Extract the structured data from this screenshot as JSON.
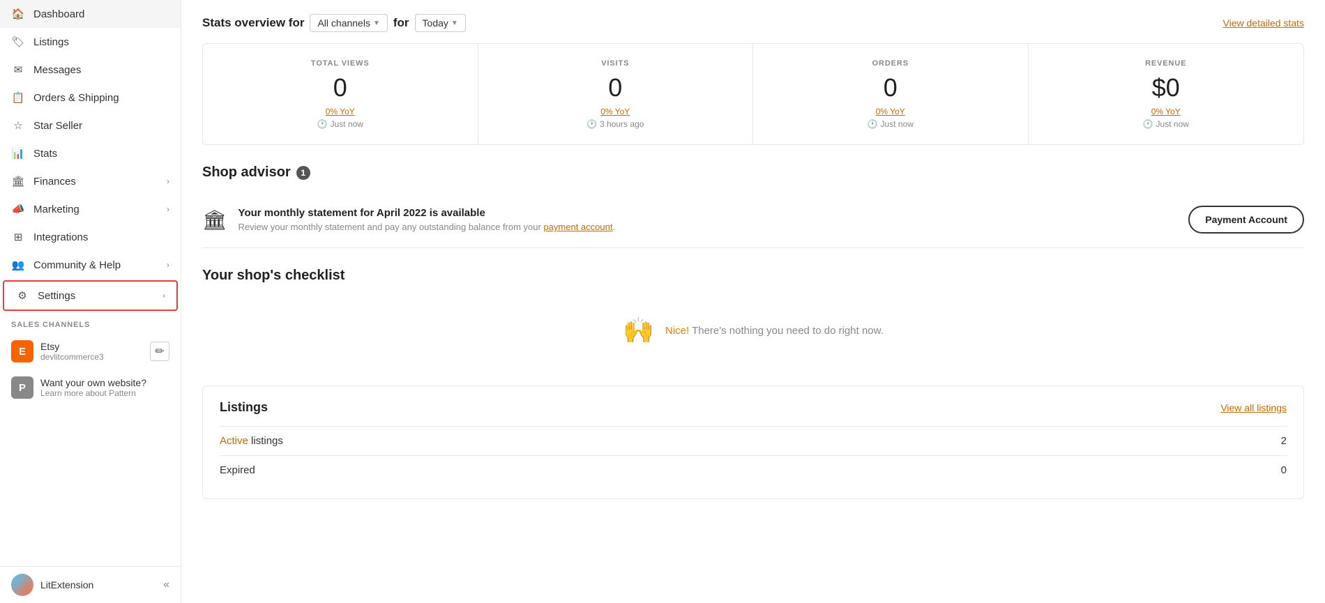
{
  "sidebar": {
    "nav_items": [
      {
        "id": "dashboard",
        "label": "Dashboard",
        "icon": "home",
        "has_chevron": false
      },
      {
        "id": "listings",
        "label": "Listings",
        "icon": "tag",
        "has_chevron": false
      },
      {
        "id": "messages",
        "label": "Messages",
        "icon": "mail",
        "has_chevron": false
      },
      {
        "id": "orders",
        "label": "Orders & Shipping",
        "icon": "clipboard",
        "has_chevron": false
      },
      {
        "id": "star-seller",
        "label": "Star Seller",
        "icon": "star",
        "has_chevron": false
      },
      {
        "id": "stats",
        "label": "Stats",
        "icon": "bar-chart",
        "has_chevron": false
      },
      {
        "id": "finances",
        "label": "Finances",
        "icon": "bank",
        "has_chevron": true
      },
      {
        "id": "marketing",
        "label": "Marketing",
        "icon": "megaphone",
        "has_chevron": true
      },
      {
        "id": "integrations",
        "label": "Integrations",
        "icon": "grid",
        "has_chevron": false
      },
      {
        "id": "community",
        "label": "Community & Help",
        "icon": "people",
        "has_chevron": true
      },
      {
        "id": "settings",
        "label": "Settings",
        "icon": "gear",
        "has_chevron": true
      }
    ],
    "sales_channels_header": "SALES CHANNELS",
    "etsy_channel": {
      "badge": "E",
      "name": "Etsy",
      "sub": "devlitcommerce3"
    },
    "pattern_channel": {
      "badge": "P",
      "name": "Want your own website?",
      "sub": "Learn more about Pattern"
    },
    "footer": {
      "label": "LitExtension",
      "collapse_icon": "«"
    }
  },
  "main": {
    "stats_overview": {
      "title": "Stats overview for",
      "channel_dropdown": "All channels",
      "for_label": "for",
      "period_dropdown": "Today",
      "view_detailed_link": "View detailed stats",
      "cards": [
        {
          "label": "TOTAL VIEWS",
          "value": "0",
          "yoy": "0% YoY",
          "time": "Just now"
        },
        {
          "label": "VISITS",
          "value": "0",
          "yoy": "0% YoY",
          "time": "3 hours ago"
        },
        {
          "label": "ORDERS",
          "value": "0",
          "yoy": "0% YoY",
          "time": "Just now"
        },
        {
          "label": "REVENUE",
          "value": "$0",
          "yoy": "0% YoY",
          "time": "Just now"
        }
      ]
    },
    "shop_advisor": {
      "title": "Shop advisor",
      "badge": "1",
      "card": {
        "heading": "Your monthly statement for April 2022 is available",
        "description": "Review your monthly statement and pay any outstanding balance from your payment account.",
        "link_text": "payment account",
        "button_label": "Payment Account"
      }
    },
    "checklist": {
      "title": "Your shop's checklist",
      "empty_message": "Nice! There's nothing you need to do right now."
    },
    "listings": {
      "title": "Listings",
      "view_all_link": "View all listings",
      "rows": [
        {
          "name": "Active listings",
          "highlight": "Active",
          "count": "2"
        },
        {
          "name": "Expired",
          "highlight": "",
          "count": "0"
        }
      ]
    }
  }
}
